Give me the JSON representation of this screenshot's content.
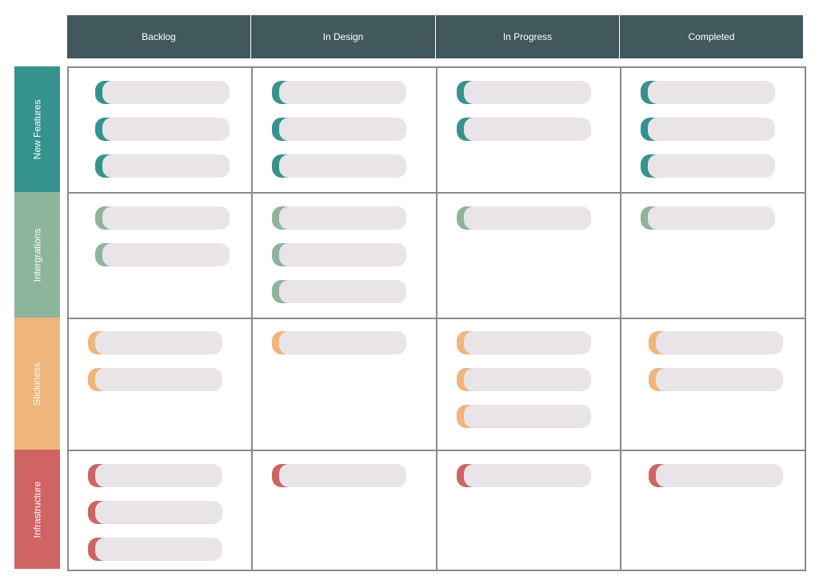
{
  "columns": [
    "Backlog",
    "In Design",
    "In Progress",
    "Completed"
  ],
  "header_color": "#41595c",
  "card_color": "#e8e4e8",
  "rows": [
    {
      "label": "New Features",
      "color": "#35938d",
      "cards_per_column": [
        3,
        3,
        2,
        3
      ]
    },
    {
      "label": "Intergrations",
      "color": "#8db59b",
      "cards_per_column": [
        2,
        3,
        1,
        1
      ]
    },
    {
      "label": "Stickiness",
      "color": "#f0b57a",
      "cards_per_column": [
        2,
        1,
        3,
        2
      ]
    },
    {
      "label": "Infrastructure",
      "color": "#cf6462",
      "cards_per_column": [
        3,
        1,
        1,
        1
      ]
    }
  ]
}
